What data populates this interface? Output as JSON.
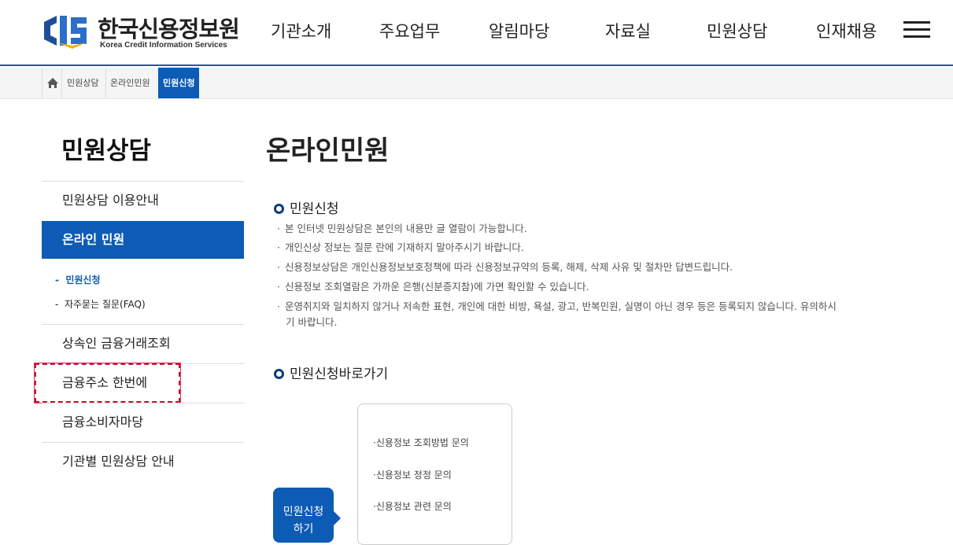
{
  "header": {
    "logo_ko": "한국신용정보원",
    "logo_en": "Korea Credit Information Services",
    "menu": [
      "기관소개",
      "주요업무",
      "알림마당",
      "자료실",
      "민원상담",
      "인재채용"
    ]
  },
  "breadcrumb": {
    "items": [
      "민원상담",
      "온라인민원",
      "민원신청"
    ]
  },
  "lnb": {
    "title": "민원상담",
    "items": [
      "민원상담 이용안내",
      "온라인 민원",
      "상속인 금융거래조회",
      "금융주소 한번에",
      "금융소비자마당",
      "기관별 민원상담 안내"
    ],
    "sub_items": [
      "민원신청",
      "자주묻는 질문(FAQ)"
    ]
  },
  "content": {
    "page_title": "온라인민원",
    "section1_title": "민원신청",
    "bullets": [
      "본 인터넷 민원상담은 본인의 내용만 글 열람이 가능합니다.",
      "개인신상 정보는 질문 란에 기재하지 말아주시기 바랍니다.",
      "신용정보상담은 개인신용정보보호정책에 따라 신용정보규약의 등록, 해제, 삭제 사유 및 절차만 답변드립니다.",
      "신용정보 조회열람은 가까운 은행(신분증지참)에 가면 확인할 수 있습니다.",
      "운영취지와 일치하지 않거나 저속한 표현, 개인에 대한 비방, 욕설, 광고, 반복민원, 실명이 아닌 경우 등은 등록되지 않습니다. 유의하시",
      "기 바랍니다."
    ],
    "section2_title": "민원신청바로가기",
    "shortcut_links": [
      "·신용정보 조회방법 문의",
      "·신용정보 정정 문의",
      "·신용정보 관련 문의"
    ],
    "go_button": "민원신청\n하기"
  },
  "colors": {
    "brand_blue": "#0d5bb5",
    "focus_red": "#c8102e"
  }
}
